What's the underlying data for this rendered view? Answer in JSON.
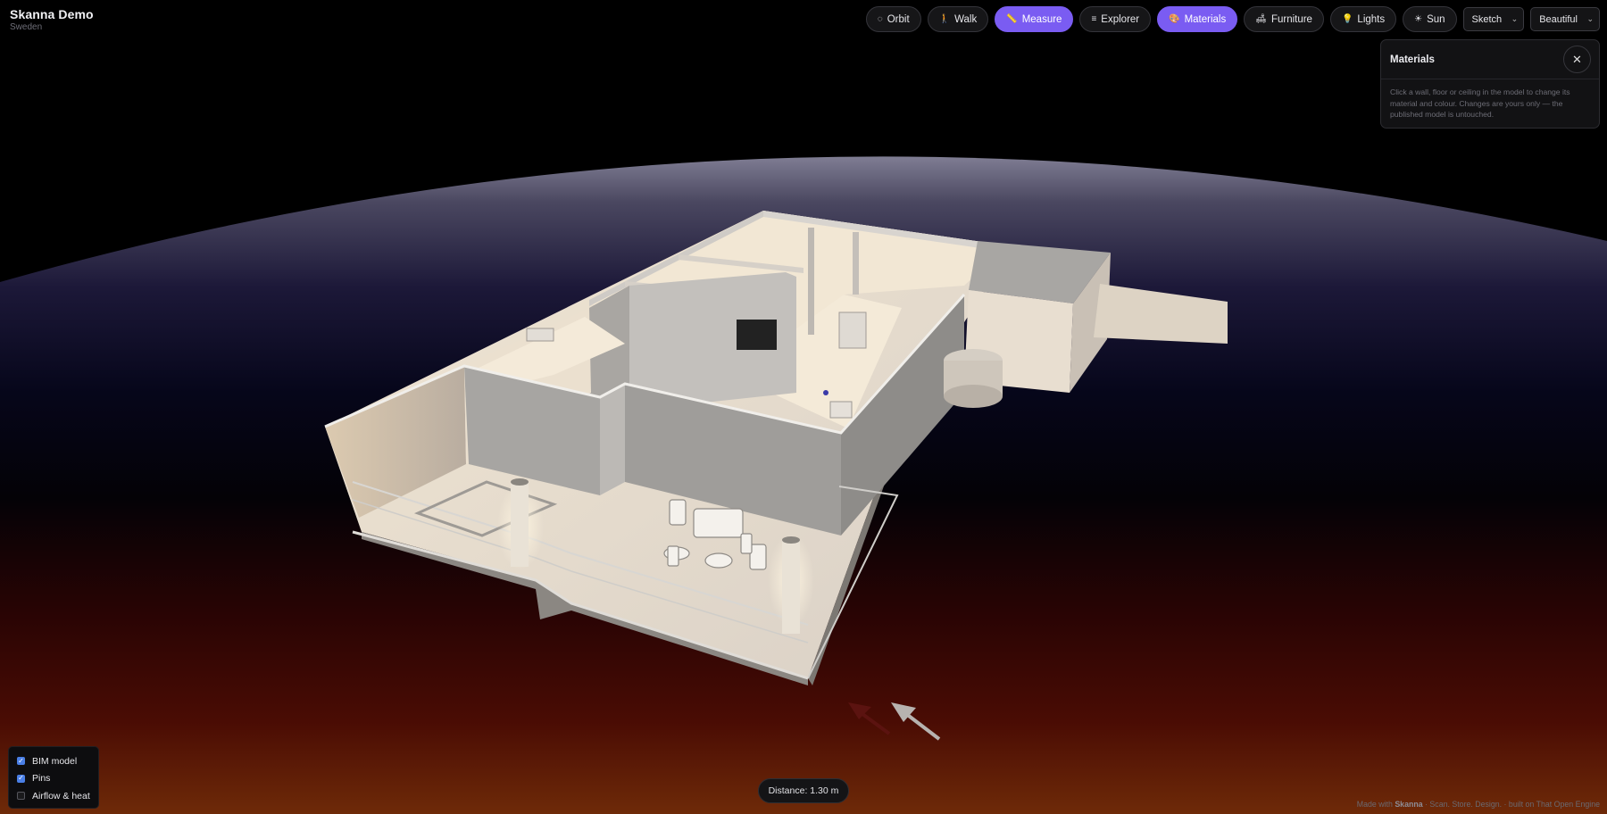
{
  "brand": {
    "title": "Skanna Demo",
    "subtitle": "Sweden"
  },
  "toolbar": {
    "orbit": {
      "icon": "orbit-icon",
      "label": "Orbit",
      "active": false
    },
    "walk": {
      "icon": "walk-icon",
      "label": "Walk",
      "active": false
    },
    "measure": {
      "icon": "ruler-icon",
      "label": "Measure",
      "active": true
    },
    "explorer": {
      "icon": "list-icon",
      "label": "Explorer",
      "active": false
    },
    "materials": {
      "icon": "palette-icon",
      "label": "Materials",
      "active": true
    },
    "furniture": {
      "icon": "sofa-icon",
      "label": "Furniture",
      "active": false
    },
    "lights": {
      "icon": "bulb-icon",
      "label": "Lights",
      "active": false
    },
    "sun": {
      "icon": "sun-icon",
      "label": "Sun",
      "active": false
    },
    "style_select": {
      "value": "Sketch"
    },
    "quality_select": {
      "value": "Beautiful"
    }
  },
  "materials_panel": {
    "title": "Materials",
    "close_label": "✕",
    "description": "Click a wall, floor or ceiling in the model to change its material and colour. Changes are yours only — the published model is untouched."
  },
  "layers": [
    {
      "label": "BIM model",
      "checked": true
    },
    {
      "label": "Pins",
      "checked": true
    },
    {
      "label": "Airflow & heat",
      "checked": false
    }
  ],
  "distance": {
    "label": "Distance: 1.30 m"
  },
  "footer": {
    "prefix": "Made with",
    "brand": "Skanna",
    "suffix": "· Scan. Store. Design. · built on That Open Engine"
  },
  "colors": {
    "accent": "#7a5cf2",
    "checkbox": "#4a7fe6",
    "background": "#000000"
  }
}
